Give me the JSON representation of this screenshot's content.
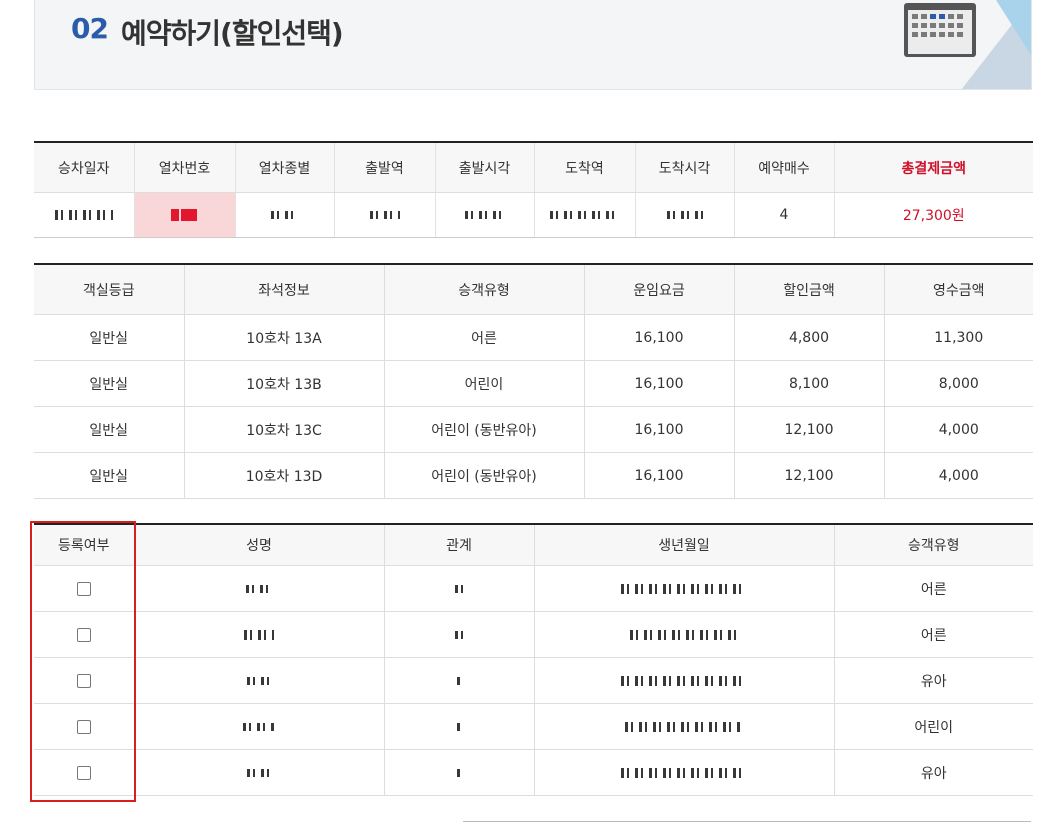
{
  "header": {
    "step_number": "02",
    "title": "예약하기(할인선택)",
    "icon": "calendar-grid-icon"
  },
  "train_table": {
    "headers": [
      "승차일자",
      "열차번호",
      "열차종별",
      "출발역",
      "출발시각",
      "도착역",
      "도착시각",
      "예약매수",
      "총결제금액"
    ],
    "row": {
      "tickets": "4",
      "total": "27,300원"
    }
  },
  "fare_table": {
    "headers": [
      "객실등급",
      "좌석정보",
      "승객유형",
      "운임요금",
      "할인금액",
      "영수금액"
    ],
    "rows": [
      {
        "class": "일반실",
        "seat": "10호차 13A",
        "type": "어른",
        "fare": "16,100",
        "discount": "4,800",
        "paid": "11,300"
      },
      {
        "class": "일반실",
        "seat": "10호차 13B",
        "type": "어린이",
        "fare": "16,100",
        "discount": "8,100",
        "paid": "8,000"
      },
      {
        "class": "일반실",
        "seat": "10호차 13C",
        "type": "어린이 (동반유아)",
        "fare": "16,100",
        "discount": "12,100",
        "paid": "4,000"
      },
      {
        "class": "일반실",
        "seat": "10호차 13D",
        "type": "어린이 (동반유아)",
        "fare": "16,100",
        "discount": "12,100",
        "paid": "4,000"
      }
    ]
  },
  "passenger_table": {
    "headers": [
      "등록여부",
      "성명",
      "관계",
      "생년월일",
      "승객유형"
    ],
    "rows": [
      {
        "type": "어른"
      },
      {
        "type": "어른"
      },
      {
        "type": "유아"
      },
      {
        "type": "어린이"
      },
      {
        "type": "유아"
      }
    ]
  },
  "colors": {
    "accent_blue": "#2a5caa",
    "total_red": "#d0102a",
    "highlight_red": "#d81e1e"
  }
}
